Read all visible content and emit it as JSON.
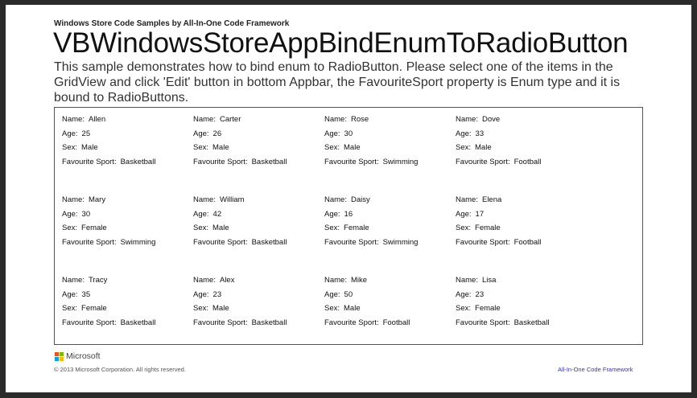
{
  "header": {
    "caption": "Windows Store Code Samples by All-In-One Code Framework",
    "title": "VBWindowsStoreAppBindEnumToRadioButton",
    "description": "This sample demonstrates how to bind enum to RadioButton. Please select one of the items in the GridView and click 'Edit' button in bottom Appbar, the FavouriteSport property is Enum type and it is bound to RadioButtons."
  },
  "labels": {
    "name": "Name:",
    "age": "Age:",
    "sex": "Sex:",
    "sport": "Favourite Sport:"
  },
  "people": [
    {
      "name": "Allen",
      "age": "25",
      "sex": "Male",
      "sport": "Basketball"
    },
    {
      "name": "Carter",
      "age": "26",
      "sex": "Male",
      "sport": "Basketball"
    },
    {
      "name": "Rose",
      "age": "30",
      "sex": "Male",
      "sport": "Swimming"
    },
    {
      "name": "Dove",
      "age": "33",
      "sex": "Male",
      "sport": "Football"
    },
    {
      "name": "Mary",
      "age": "30",
      "sex": "Female",
      "sport": "Swimming"
    },
    {
      "name": "William",
      "age": "42",
      "sex": "Male",
      "sport": "Basketball"
    },
    {
      "name": "Daisy",
      "age": "16",
      "sex": "Female",
      "sport": "Swimming"
    },
    {
      "name": "Elena",
      "age": "17",
      "sex": "Female",
      "sport": "Football"
    },
    {
      "name": "Tracy",
      "age": "35",
      "sex": "Female",
      "sport": "Basketball"
    },
    {
      "name": "Alex",
      "age": "23",
      "sex": "Male",
      "sport": "Basketball"
    },
    {
      "name": "Mike",
      "age": "50",
      "sex": "Male",
      "sport": "Football"
    },
    {
      "name": "Lisa",
      "age": "23",
      "sex": "Female",
      "sport": "Basketball"
    }
  ],
  "footer": {
    "brand": "Microsoft",
    "copyright": "© 2013 Microsoft Corporation. All rights reserved.",
    "framework_link": "All-In-One Code Framework"
  },
  "colors": {
    "ms_red": "#f25022",
    "ms_green": "#7fba00",
    "ms_blue": "#00a4ef",
    "ms_yellow": "#ffb900",
    "link": "#3333cc"
  }
}
